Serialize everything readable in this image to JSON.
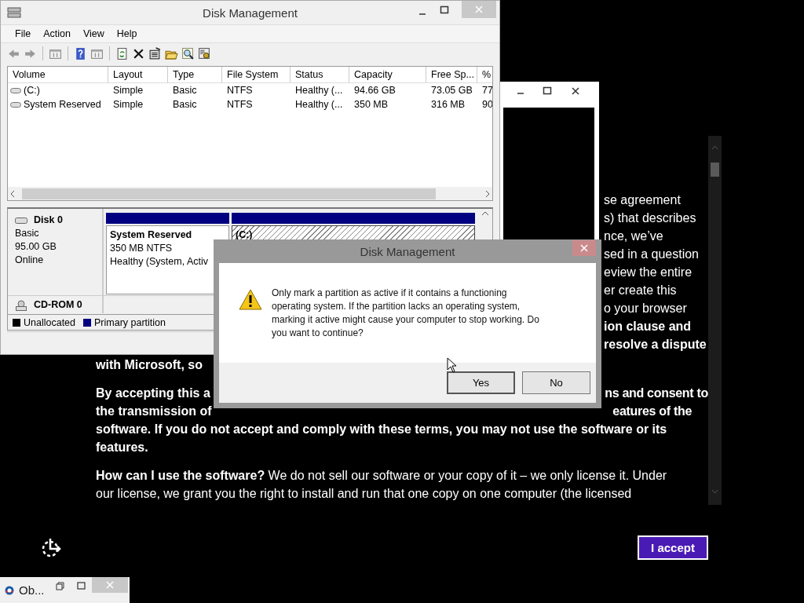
{
  "license": {
    "fragments": [
      {
        "text": "se agreement",
        "bold": false
      },
      {
        "text": "s) that describes",
        "bold": false
      },
      {
        "text": "nce, we’ve",
        "bold": false
      },
      {
        "text": "sed in a question",
        "bold": false
      },
      {
        "text": "eview the entire",
        "bold": false
      },
      {
        "text": "er create this",
        "bold": false
      },
      {
        "text": "o your browser",
        "bold": false
      },
      {
        "text": "ion clause and",
        "bold": true
      },
      {
        "text": "resolve a dispute",
        "bold": true
      }
    ],
    "paragraphs": [
      [
        {
          "left": "with Microsoft, so",
          "bold": true
        }
      ],
      [
        {
          "left": "By accepting this a",
          "right": "ns and consent to",
          "bold": true
        },
        {
          "left": "the transmission of",
          "right": "eatures of the",
          "bold": true
        },
        {
          "left": "software. If you do not accept and comply with these terms, you may not use the software or its",
          "bold": true
        },
        {
          "left": "features.",
          "bold": true
        }
      ],
      [
        {
          "left": "**How can I use the software?** We do not sell our software or your copy of it – we only license it. Under",
          "bold": false
        },
        {
          "left": "our license, we grant you the right to install and run that one copy on one computer (the licensed",
          "bold": false
        }
      ]
    ]
  },
  "accept_button": {
    "label": "I accept"
  },
  "taskbar_window": {
    "title": "Ob..."
  },
  "disk_window": {
    "title": "Disk Management",
    "menu": [
      "File",
      "Action",
      "View",
      "Help"
    ],
    "columns": [
      "Volume",
      "Layout",
      "Type",
      "File System",
      "Status",
      "Capacity",
      "Free Sp...",
      "%"
    ],
    "rows": [
      [
        "(C:)",
        "Simple",
        "Basic",
        "NTFS",
        "Healthy (...",
        "94.66 GB",
        "73.05 GB",
        "77"
      ],
      [
        "System Reserved",
        "Simple",
        "Basic",
        "NTFS",
        "Healthy (...",
        "350 MB",
        "316 MB",
        "90"
      ]
    ],
    "disks": [
      {
        "name": "Disk 0",
        "kind": "disk",
        "details": [
          "Basic",
          "95.00 GB",
          "Online"
        ],
        "partitions": [
          {
            "name": "System Reserved",
            "size": "350 MB NTFS",
            "status": "Healthy (System, Activ",
            "selected": false
          },
          {
            "name": "(C:)",
            "selected": true
          }
        ]
      },
      {
        "name": "CD-ROM 0",
        "kind": "cdrom"
      }
    ],
    "legend": [
      {
        "label": "Unallocated",
        "color": "#000000"
      },
      {
        "label": "Primary partition",
        "color": "#000080"
      }
    ]
  },
  "dialog": {
    "title": "Disk Management",
    "message": "Only mark a partition as active if it contains a functioning operating system. If the partition lacks an operating system, marking it active might cause your computer to stop working. Do you want to continue?",
    "buttons": [
      {
        "label": "Yes",
        "default": true
      },
      {
        "label": "No",
        "default": false
      }
    ]
  }
}
